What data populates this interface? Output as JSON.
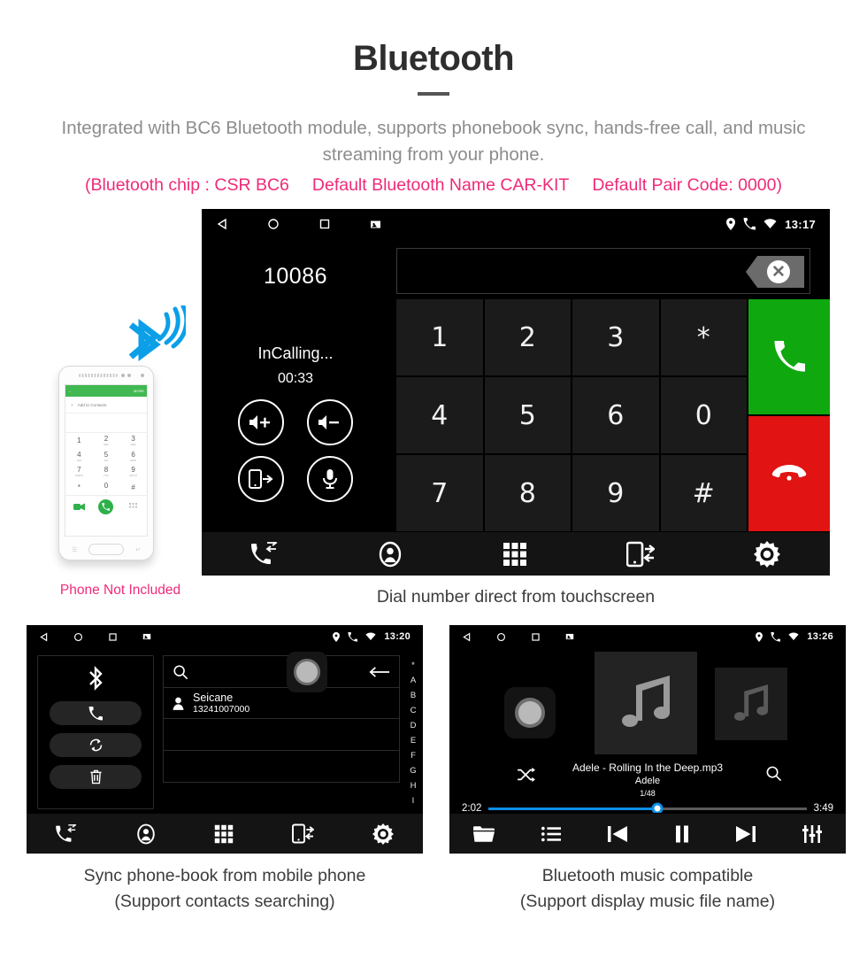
{
  "header": {
    "title": "Bluetooth",
    "subtitle": "Integrated with BC6 Bluetooth module, supports phonebook sync, hands-free call, and music streaming from your phone.",
    "spec_chip": "(Bluetooth chip : CSR BC6",
    "spec_name": "Default Bluetooth Name CAR-KIT",
    "spec_pair": "Default Pair Code: 0000)"
  },
  "colors": {
    "accent_pink": "#ef2a78",
    "answer_green": "#0fa80f",
    "hangup_red": "#e21313",
    "progress_blue": "#0e8ee8",
    "phone_green": "#41b851"
  },
  "dialer": {
    "status": {
      "time": "13:17"
    },
    "dialed_number": "10086",
    "call_state": "InCalling...",
    "call_timer": "00:33",
    "controls": [
      {
        "name": "volume-up",
        "label": "Volume Up"
      },
      {
        "name": "volume-down",
        "label": "Volume Down"
      },
      {
        "name": "transfer-audio",
        "label": "Transfer To Phone"
      },
      {
        "name": "mute-mic",
        "label": "Mute Microphone"
      }
    ],
    "input_value": "",
    "keys": [
      "1",
      "2",
      "3",
      "*",
      "4",
      "5",
      "6",
      "0",
      "7",
      "8",
      "9",
      "#"
    ],
    "answer_label": "Answer",
    "hangup_label": "Hang Up",
    "navbar": [
      {
        "name": "call-log",
        "label": "Call Log"
      },
      {
        "name": "contacts",
        "label": "Contacts"
      },
      {
        "name": "keypad",
        "label": "Keypad"
      },
      {
        "name": "phone-sync",
        "label": "Phone Sync"
      },
      {
        "name": "settings",
        "label": "Settings"
      }
    ],
    "caption": "Dial number direct from touchscreen"
  },
  "phone_mock": {
    "appbar_more": "MORE",
    "add_to_contacts": "Add to Contacts",
    "keys": [
      {
        "d": "1",
        "s": ""
      },
      {
        "d": "2",
        "s": "ABC"
      },
      {
        "d": "3",
        "s": "DEF"
      },
      {
        "d": "4",
        "s": "GHI"
      },
      {
        "d": "5",
        "s": "JKL"
      },
      {
        "d": "6",
        "s": "MNO"
      },
      {
        "d": "7",
        "s": "PQRS"
      },
      {
        "d": "8",
        "s": "TUV"
      },
      {
        "d": "9",
        "s": "WXYZ"
      },
      {
        "d": "*",
        "s": ""
      },
      {
        "d": "0",
        "s": "+"
      },
      {
        "d": "#",
        "s": ""
      }
    ],
    "not_included_note": "Phone Not Included"
  },
  "phonebook": {
    "status": {
      "time": "13:20"
    },
    "side_buttons": [
      {
        "name": "bluetooth",
        "label": "Bluetooth"
      },
      {
        "name": "dial",
        "label": "Dial"
      },
      {
        "name": "sync",
        "label": "Sync"
      },
      {
        "name": "delete",
        "label": "Delete"
      }
    ],
    "search_placeholder": "",
    "search_value": "",
    "contacts": [
      {
        "name": "Seicane",
        "number": "13241007000"
      }
    ],
    "index_letters": [
      "*",
      "A",
      "B",
      "C",
      "D",
      "E",
      "F",
      "G",
      "H",
      "I"
    ],
    "navbar": [
      {
        "name": "call-log",
        "label": "Call Log"
      },
      {
        "name": "contacts",
        "label": "Contacts"
      },
      {
        "name": "keypad",
        "label": "Keypad"
      },
      {
        "name": "phone-sync",
        "label": "Phone Sync"
      },
      {
        "name": "settings",
        "label": "Settings"
      }
    ],
    "caption_line1": "Sync phone-book from mobile phone",
    "caption_line2": "(Support contacts searching)"
  },
  "music": {
    "status": {
      "time": "13:26"
    },
    "track_title": "Adele - Rolling In the Deep.mp3",
    "artist": "Adele",
    "track_count": "1/48",
    "elapsed": "2:02",
    "duration": "3:49",
    "progress_percent": 53,
    "navbar": [
      {
        "name": "folder",
        "label": "Folder"
      },
      {
        "name": "playlist",
        "label": "Playlist"
      },
      {
        "name": "previous",
        "label": "Previous"
      },
      {
        "name": "pause",
        "label": "Pause"
      },
      {
        "name": "next",
        "label": "Next"
      },
      {
        "name": "equalizer",
        "label": "Equalizer"
      }
    ],
    "caption_line1": "Bluetooth music compatible",
    "caption_line2": "(Support display music file name)"
  }
}
